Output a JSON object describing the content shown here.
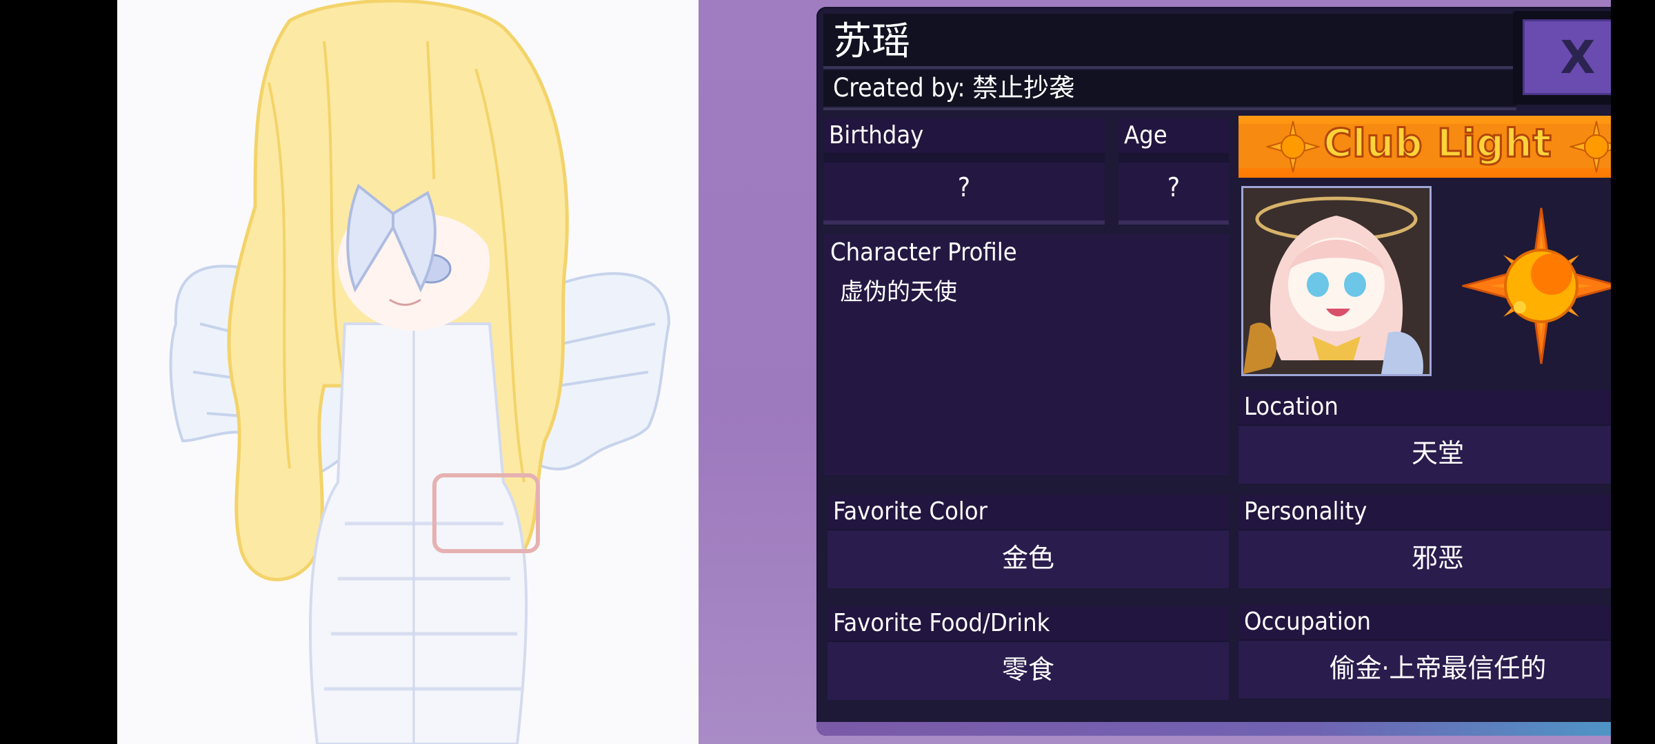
{
  "character": {
    "name": "苏瑶",
    "created_by": "Created by: 禁止抄袭"
  },
  "close_label": "X",
  "birthday": {
    "label": "Birthday",
    "value": "?"
  },
  "age": {
    "label": "Age",
    "value": "?"
  },
  "profile": {
    "label": "Character Profile",
    "value": "虚伪的天使"
  },
  "club": {
    "name": "Club Light"
  },
  "location": {
    "label": "Location",
    "value": "天堂"
  },
  "favorite_color": {
    "label": "Favorite Color",
    "value": "金色"
  },
  "personality": {
    "label": "Personality",
    "value": "邪恶"
  },
  "favorite_food": {
    "label": "Favorite Food/Drink",
    "value": "零食"
  },
  "occupation": {
    "label": "Occupation",
    "value": "偷金·上帝最信任的"
  },
  "colors": {
    "panel": "#1d1936",
    "field_value": "#2a1c4d",
    "close_button": "#6a4bb0",
    "club_orange": "#ff8a10",
    "club_gold": "#ffd43a"
  },
  "icons": [
    "close-icon",
    "sun-emblem-icon",
    "sun-small-icon"
  ]
}
